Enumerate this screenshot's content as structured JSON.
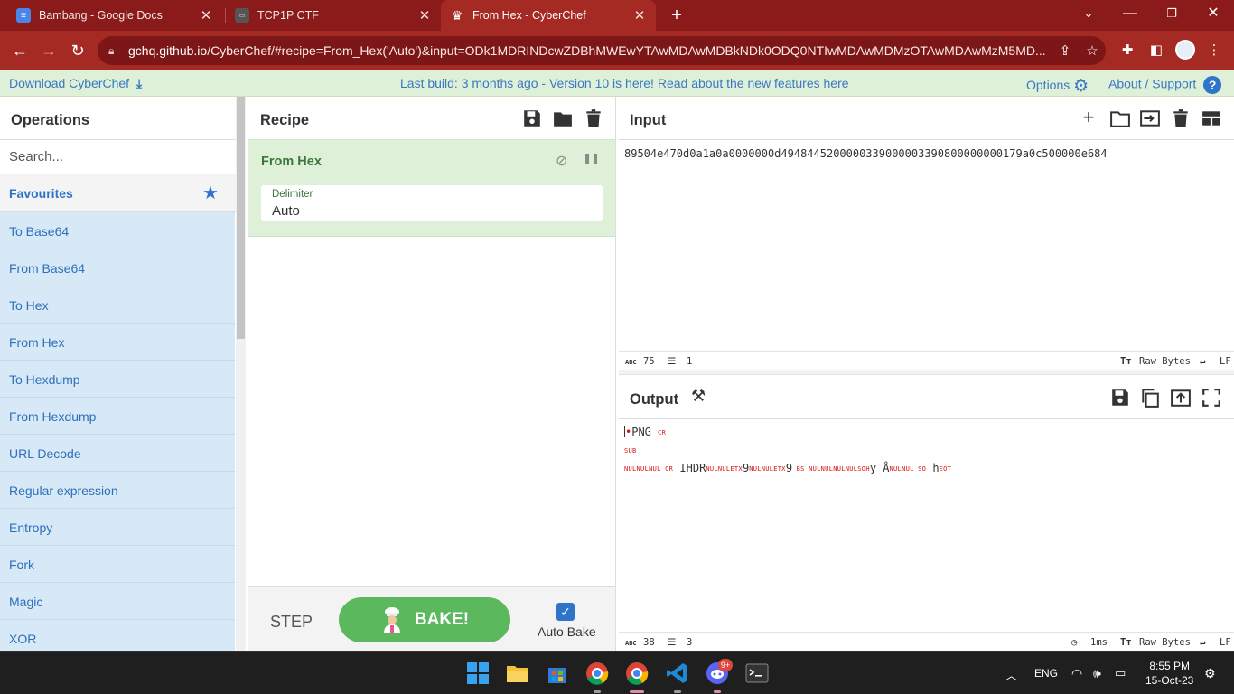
{
  "browser": {
    "tabs": [
      {
        "title": "Bambang - Google Docs",
        "icon": "google-docs-icon"
      },
      {
        "title": "TCP1P CTF",
        "icon": "site-icon"
      },
      {
        "title": "From Hex - CyberChef",
        "icon": "cyberchef-icon",
        "active": true
      }
    ],
    "url_host": "gchq.github.io",
    "url_rest": "/CyberChef/#recipe=From_Hex('Auto')&input=ODk1MDRINDcwZDBhMWEwYTAwMDAwMDBkNDk0ODQ0NTIwMDAwMDMzOTAwMDAwMzM5MD..."
  },
  "banner": {
    "download": "Download CyberChef",
    "message": "Last build: 3 months ago - Version 10 is here! Read about the new features here",
    "options": "Options",
    "about": "About / Support"
  },
  "operations": {
    "title": "Operations",
    "search_placeholder": "Search...",
    "favourites": "Favourites",
    "items": [
      "To Base64",
      "From Base64",
      "To Hex",
      "From Hex",
      "To Hexdump",
      "From Hexdump",
      "URL Decode",
      "Regular expression",
      "Entropy",
      "Fork",
      "Magic",
      "XOR"
    ]
  },
  "recipe": {
    "title": "Recipe",
    "operation": "From Hex",
    "arg_label": "Delimiter",
    "arg_value": "Auto",
    "step": "STEP",
    "bake": "BAKE!",
    "auto_bake": "Auto Bake"
  },
  "input": {
    "title": "Input",
    "text": "89504e470d0a1a0a0000000d4948445200000339000003390800000000179a0c500000e684",
    "chars": "75",
    "lines": "1",
    "encoding": "Raw Bytes",
    "eol": "LF"
  },
  "output": {
    "title": "Output",
    "line1_text": "PNG",
    "line1_ctl": "CR",
    "line2_ctl": "SUB",
    "line3": {
      "c1": "NULNULNUL CR",
      "t1": " IHDR",
      "c2": "NULNULETX",
      "t2": "9",
      "c3": "NULNULETX",
      "t3": "9",
      "c4": " BS NULNULNULNULSOH",
      "t4": "y Å",
      "c5": "NULNUL SO",
      "t5": " h",
      "c6": "EOT"
    },
    "chars": "38",
    "lines": "3",
    "time": "1ms",
    "encoding": "Raw Bytes",
    "eol": "LF"
  },
  "taskbar": {
    "lang": "ENG",
    "time": "8:55 PM",
    "date": "15-Oct-23",
    "badge": "9+"
  },
  "colors": {
    "browser_frame": "#8b1a1a",
    "banner_bg": "#dff0d8",
    "link_blue": "#2f74c8",
    "bake_green": "#5cb85c",
    "op_item_bg": "#d7e9f7"
  }
}
